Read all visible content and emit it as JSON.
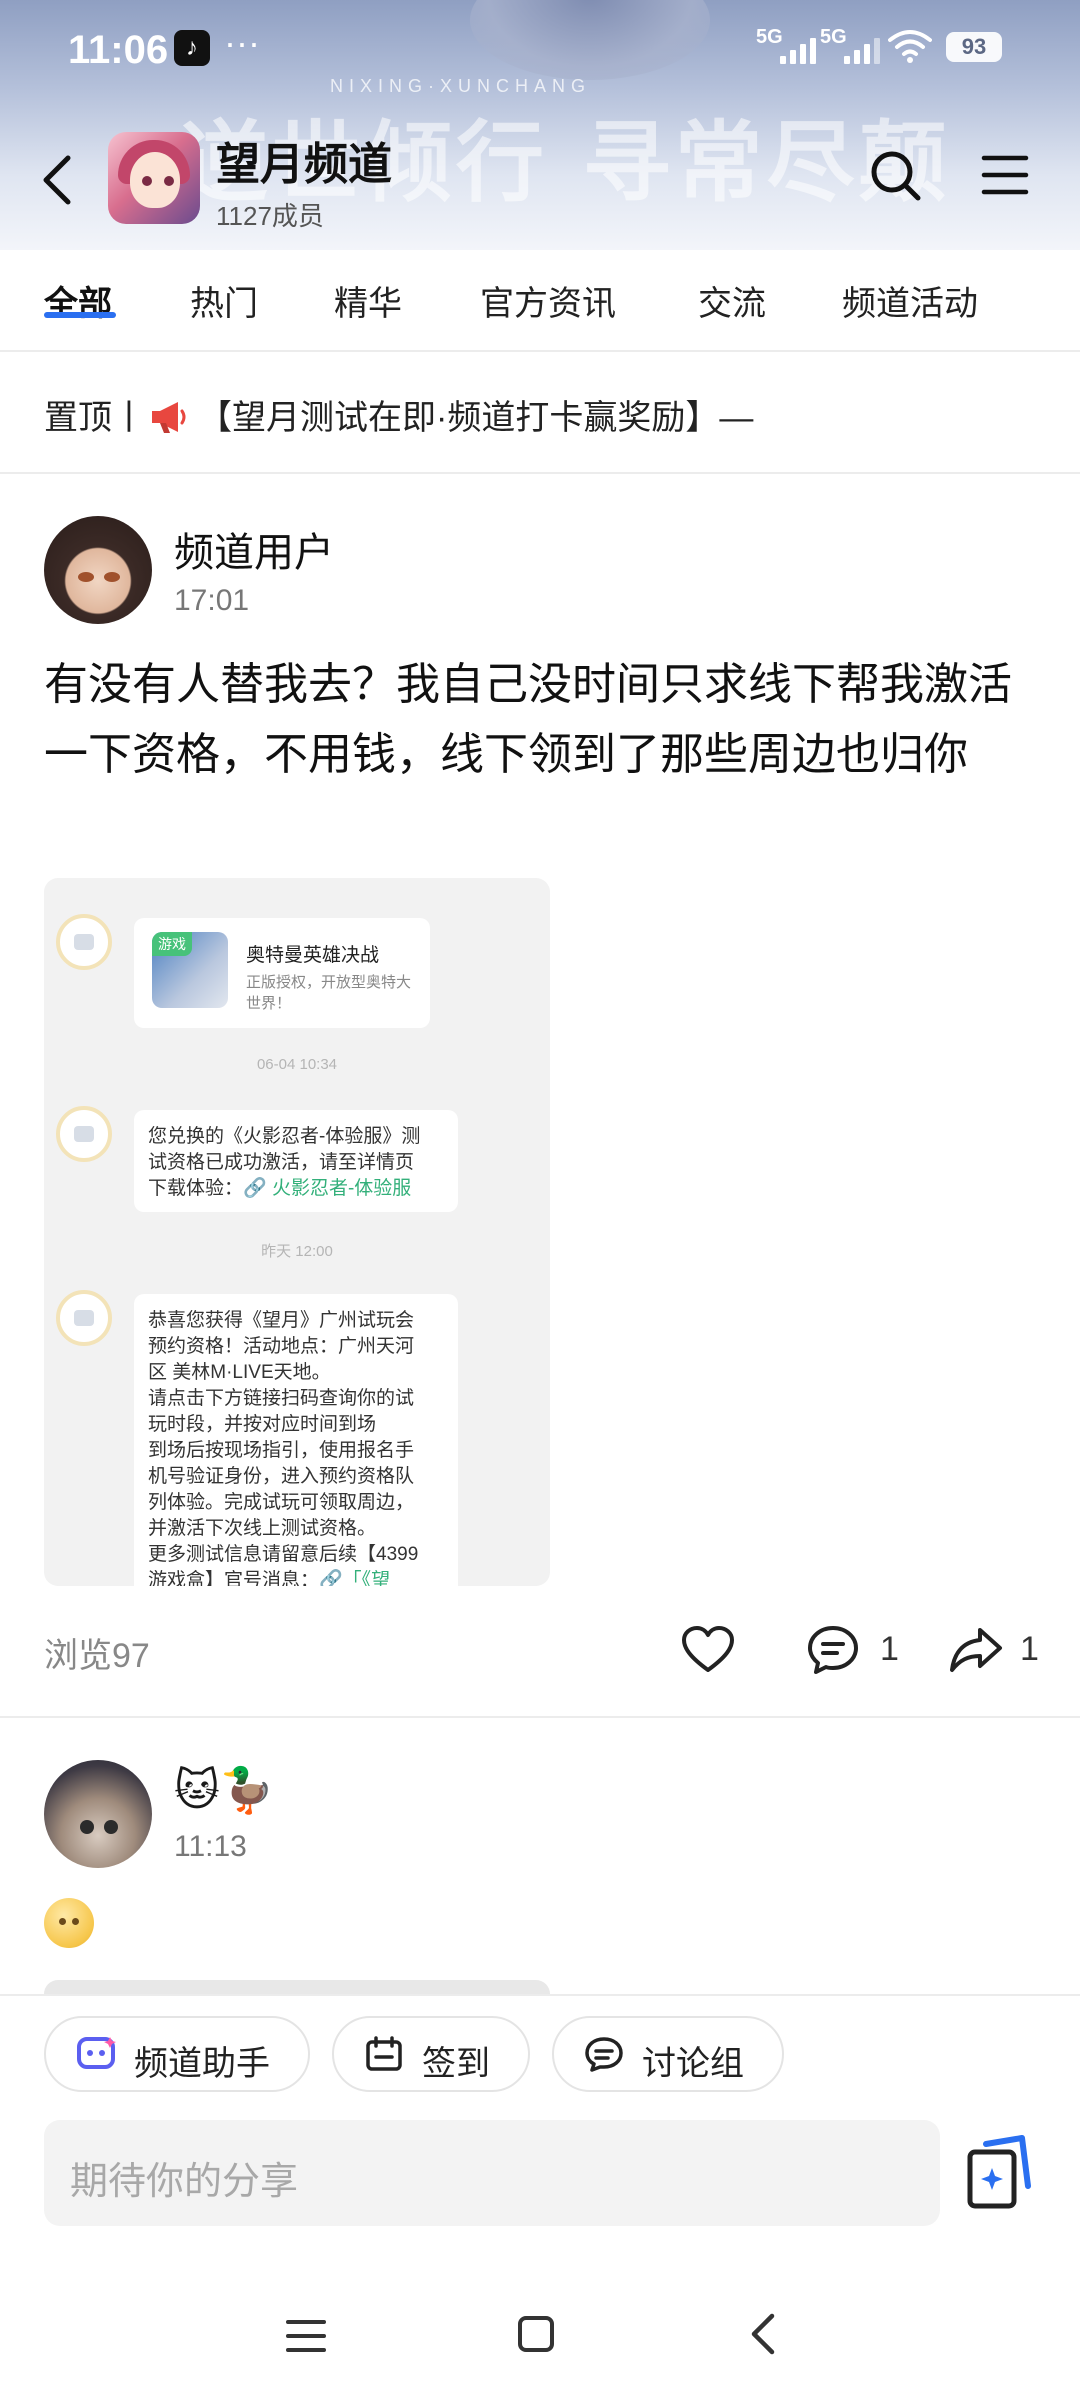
{
  "status_bar": {
    "time": "11:06",
    "more": "···",
    "net1": "5G",
    "net2": "5G",
    "battery": "93"
  },
  "banner": {
    "art_title": "逆世倾行 寻常尽颠",
    "art_subtitle": "NIXING·XUNCHANG"
  },
  "header": {
    "channel_name": "望月频道",
    "member_count": "1127成员"
  },
  "tabs": [
    {
      "label": "全部",
      "active": true
    },
    {
      "label": "热门"
    },
    {
      "label": "精华"
    },
    {
      "label": "官方资讯"
    },
    {
      "label": "交流"
    },
    {
      "label": "频道活动"
    }
  ],
  "pinned": {
    "prefix": "置顶丨",
    "title": "【望月测试在即·频道打卡赢奖励】—"
  },
  "post": {
    "username": "频道用户",
    "time": "17:01",
    "text": "有没有人替我去？我自己没时间只求线下帮我激活一下资格，不用钱，线下领到了那些周边也归你",
    "image": {
      "game_tag": "游戏",
      "game_name": "奥特曼英雄决战",
      "game_desc": "正版授权，开放型奥特大世界！",
      "ts1": "06-04 10:34",
      "msg1_a": "您兑换的《火影忍者-体验服》测",
      "msg1_b": "试资格已成功激活，请至详情页",
      "msg1_c": "下载体验：",
      "msg1_link": "🔗 火影忍者-体验服",
      "ts2": "昨天 12:00",
      "msg2_lines": [
        "恭喜您获得《望月》广州试玩会",
        "预约资格！活动地点：广州天河",
        "区 美林M·LIVE天地。",
        "请点击下方链接扫码查询你的试",
        "玩时段，并按对应时间到场",
        "到场后按现场指引，使用报名手",
        "机号验证身份，进入预约资格队",
        "列体验。完成试玩可领取周边，",
        "并激活下次线上测试资格。",
        "更多测试信息请留意后续【4399",
        "游戏盒】官号消息："
      ],
      "msg2_link": "🔗「《望"
    },
    "views": "浏览97",
    "comments": "1",
    "shares": "1"
  },
  "post2": {
    "username": "🐱🦆",
    "time": "11:13"
  },
  "bottom": {
    "chips": [
      {
        "label": "频道助手"
      },
      {
        "label": "签到"
      },
      {
        "label": "讨论组"
      }
    ],
    "composer_placeholder": "期待你的分享"
  },
  "colors": {
    "accent": "#2a6ff0",
    "link_green": "#33b07a"
  }
}
